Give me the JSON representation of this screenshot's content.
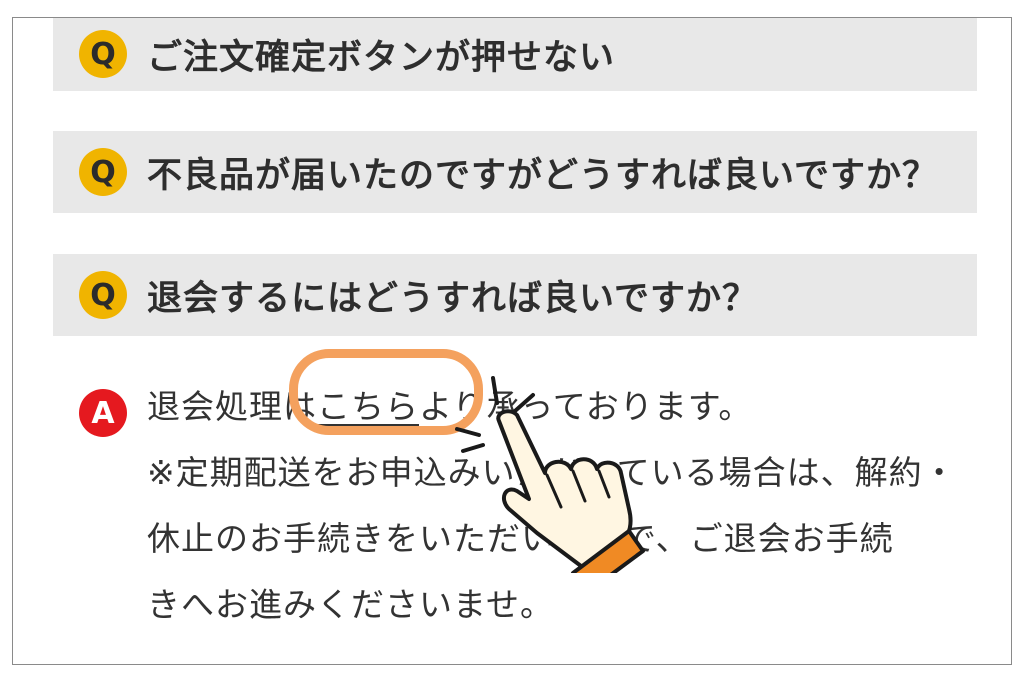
{
  "faq": {
    "questions": [
      {
        "badge": "Q",
        "text": "ご注文確定ボタンが押せない"
      },
      {
        "badge": "Q",
        "text": "不良品が届いたのですがどうすれば良いですか？"
      },
      {
        "badge": "Q",
        "text": "退会するにはどうすれば良いですか？"
      }
    ],
    "answer": {
      "badge": "A",
      "line1_before": "退会処理は",
      "link_text": "こちら",
      "line1_after": "より承っております。",
      "line2": "※定期配送をお申込みいただいている場合は、解約・",
      "line3": "休止のお手続きをいただいた上で、ご退会お手続",
      "line4": "きへお進みくださいませ。"
    }
  },
  "colors": {
    "question_bg": "#e8e8e8",
    "q_badge": "#f0b400",
    "a_badge": "#e5191f",
    "highlight": "#f4a15e",
    "hand_cuff": "#f08a24"
  },
  "overlay": {
    "icon": "pointing-hand-icon"
  }
}
